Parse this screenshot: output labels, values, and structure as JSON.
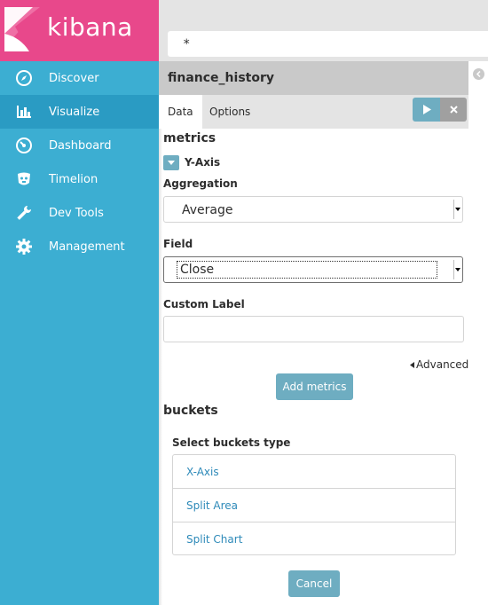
{
  "sidebar": {
    "logo_text": "kibana",
    "items": [
      {
        "label": "Discover",
        "icon": "compass-icon"
      },
      {
        "label": "Visualize",
        "icon": "bar-chart-icon"
      },
      {
        "label": "Dashboard",
        "icon": "dashboard-gauge-icon"
      },
      {
        "label": "Timelion",
        "icon": "timelion-icon"
      },
      {
        "label": "Dev Tools",
        "icon": "wrench-icon"
      },
      {
        "label": "Management",
        "icon": "gear-icon"
      }
    ],
    "active_item": "Visualize"
  },
  "query": {
    "value": "*"
  },
  "editor": {
    "index_pattern": "finance_history",
    "tabs": [
      "Data",
      "Options"
    ],
    "active_tab": "Data",
    "metrics_title": "metrics",
    "yaxis_label": "Y-Axis",
    "aggregation_label": "Aggregation",
    "aggregation_value": "Average",
    "field_label": "Field",
    "field_value": "Close",
    "custom_label_label": "Custom Label",
    "custom_label_value": "",
    "advanced_label": "Advanced",
    "add_metrics_label": "Add metrics",
    "buckets_title": "buckets",
    "select_buckets_label": "Select buckets type",
    "bucket_types": [
      "X-Axis",
      "Split Area",
      "Split Chart"
    ],
    "cancel_label": "Cancel"
  },
  "colors": {
    "sidebar": "#3caed2",
    "logo_bg": "#e8488b",
    "accent": "#6eadc1",
    "link": "#2e8ab9"
  }
}
